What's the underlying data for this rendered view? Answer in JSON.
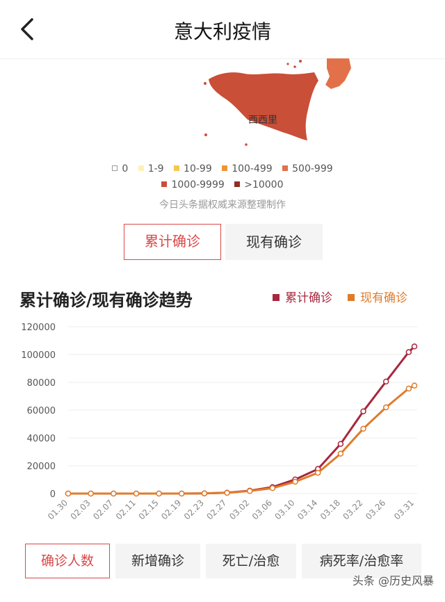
{
  "header": {
    "title": "意大利疫情",
    "back_icon": "chevron-left-icon"
  },
  "map": {
    "region_label": "西西里"
  },
  "legend": {
    "items": [
      {
        "label": "0",
        "color": "#ffffff"
      },
      {
        "label": "1-9",
        "color": "#fdf1b8"
      },
      {
        "label": "10-99",
        "color": "#f5c74f"
      },
      {
        "label": "100-499",
        "color": "#ef9535"
      },
      {
        "label": "500-999",
        "color": "#e2714a"
      },
      {
        "label": "1000-9999",
        "color": "#c94f38"
      },
      {
        "label": ">10000",
        "color": "#8f2f22"
      }
    ]
  },
  "source_note": "今日头条据权威来源整理制作",
  "map_tabs": [
    {
      "label": "累计确诊",
      "active": true
    },
    {
      "label": "现有确诊",
      "active": false
    }
  ],
  "chart_title": "累计确诊/现有确诊趋势",
  "chart_data": {
    "type": "line",
    "ylim": [
      0,
      120000
    ],
    "yticks": [
      0,
      20000,
      40000,
      60000,
      80000,
      100000,
      120000
    ],
    "xticks": [
      "01.30",
      "02.03",
      "02.07",
      "02.11",
      "02.15",
      "02.19",
      "02.23",
      "02.27",
      "03.02",
      "03.06",
      "03.10",
      "03.14",
      "03.18",
      "03.22",
      "03.26",
      "03.31"
    ],
    "x": [
      "01.30",
      "02.03",
      "02.07",
      "02.11",
      "02.15",
      "02.19",
      "02.23",
      "02.27",
      "03.02",
      "03.06",
      "03.10",
      "03.14",
      "03.18",
      "03.22",
      "03.26",
      "03.30",
      "03.31"
    ],
    "series": [
      {
        "name": "累计确诊",
        "color": "#a8273d",
        "values": [
          2,
          3,
          3,
          3,
          3,
          3,
          150,
          650,
          2036,
          4636,
          10149,
          17660,
          35713,
          59138,
          80589,
          101739,
          105792
        ]
      },
      {
        "name": "现有确诊",
        "color": "#e07b2a",
        "values": [
          2,
          3,
          3,
          3,
          3,
          3,
          148,
          528,
          1835,
          3916,
          8514,
          14955,
          28710,
          46638,
          62013,
          75528,
          77635
        ]
      }
    ]
  },
  "bottom_tabs": [
    {
      "label": "确诊人数",
      "active": true
    },
    {
      "label": "新增确诊",
      "active": false
    },
    {
      "label": "死亡/治愈",
      "active": false
    },
    {
      "label": "病死率/治愈率",
      "active": false
    }
  ],
  "watermark": "头条 @历史风暴"
}
